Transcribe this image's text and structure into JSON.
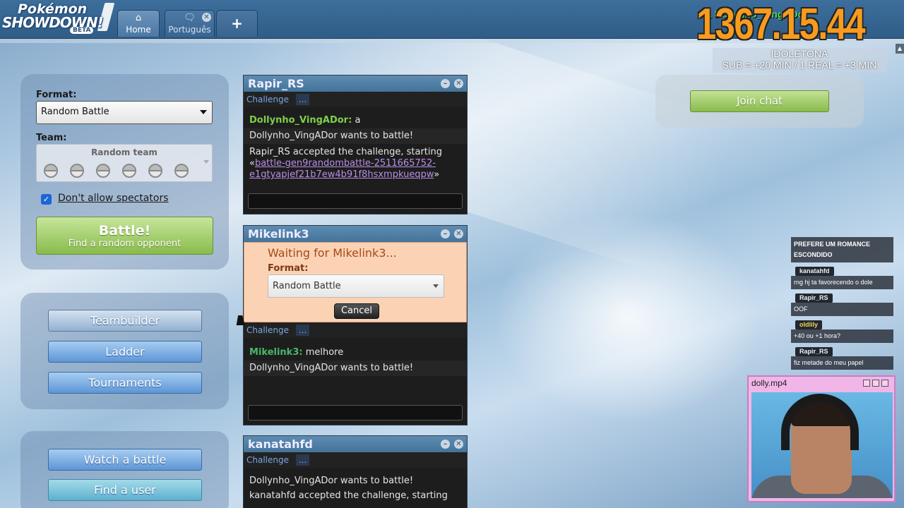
{
  "header": {
    "logo": {
      "line1": "Pokémon",
      "line2": "SHOWDOWN!",
      "badge": "BETA"
    },
    "tabs": [
      {
        "label": "Home",
        "icon": "home-icon"
      },
      {
        "label": "Português",
        "icon": "chat-bubbles-icon"
      },
      {
        "label": "+",
        "icon": "plus-icon"
      }
    ]
  },
  "stream_overlay": {
    "timer": "1367.15.44",
    "username": "1 Dollynho_VingADor",
    "channel": "IDOLETONA",
    "sub_info": "SUB = +20  MIN / 1 REAL = +3 MIN"
  },
  "battle_form": {
    "format_label": "Format:",
    "format_value": "Random Battle",
    "team_label": "Team:",
    "team_value": "Random team",
    "spectators_label": "Don't allow spectators",
    "battle_button": "Battle!",
    "battle_sub": "Find a random opponent"
  },
  "menu": {
    "teambuilder": "Teambuilder",
    "ladder": "Ladder",
    "tournaments": "Tournaments",
    "watch": "Watch a battle",
    "find_user": "Find a user"
  },
  "pm_windows": [
    {
      "name": "Rapir_RS",
      "challenge_label": "Challenge",
      "dots": "...",
      "messages": [
        {
          "user": "Dollynho_VingADor:",
          "text": "a"
        },
        {
          "text": "Dollynho_VingADor wants to battle!"
        },
        {
          "text_before": "Rapir_RS accepted the challenge, starting «",
          "link": "battle-gen9randombattle-2511665752-e1gtyapjef21b7ew4b91f8hsxmpkueqpw",
          "text_after": "»"
        }
      ]
    },
    {
      "name": "Mikelink3",
      "waiting": "Waiting for Mikelink3...",
      "format_label": "Format:",
      "format_value": "Random Battle",
      "cancel": "Cancel",
      "challenge_label": "Challenge",
      "dots": "...",
      "messages": [
        {
          "user": "Mikelink3:",
          "text": "melhore"
        },
        {
          "text": "Dollynho_VingADor wants to battle!"
        }
      ]
    },
    {
      "name": "kanatahfd",
      "challenge_label": "Challenge",
      "dots": "...",
      "messages": [
        {
          "text": "Dollynho_VingADor wants to battle!"
        },
        {
          "text": "kanatahfd accepted the challenge, starting"
        }
      ]
    }
  ],
  "join_chat": "Join chat",
  "twitch_chat": [
    {
      "user": "",
      "text": "PREFERE UM ROMANCE ESCONDIDO"
    },
    {
      "user": "kanatahfd",
      "text": "rng hj ta favorecendo o dole"
    },
    {
      "user": "Rapir_RS",
      "text": "OOF"
    },
    {
      "user": "oldlily",
      "text": "+40 ou +1 hora?"
    },
    {
      "user": "Rapir_RS",
      "text": "fiz metade do meu papel"
    }
  ],
  "webcam": {
    "title": "dolly.mp4"
  },
  "colors": {
    "accent_blue": "#5d95d6",
    "battle_green": "#89bb4c",
    "timer_orange": "#f79b1f",
    "pm_title": "#44739b"
  }
}
